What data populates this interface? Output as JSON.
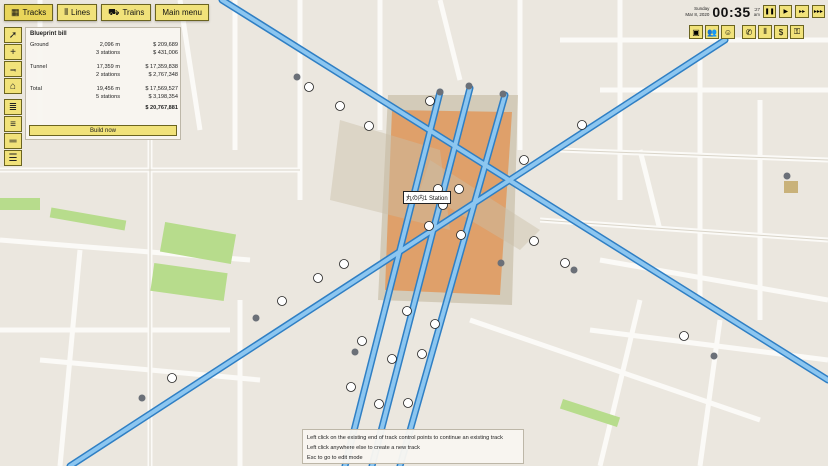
{
  "toolbar": {
    "tracks_label": "Tracks",
    "lines_label": "Lines",
    "trains_label": "Trains",
    "main_menu_label": "Main menu"
  },
  "tools": [
    "select-icon",
    "add-track-icon",
    "elevation-icon",
    "station-icon",
    "track-single-icon",
    "track-double-icon",
    "track-ground-icon",
    "track-tunnel-icon"
  ],
  "blueprint": {
    "title": "Blueprint bill",
    "ground": {
      "label": "Ground",
      "length": "2,096 m",
      "cost": "$ 209,689",
      "stations": "3 stations",
      "stations_cost": "$ 431,006"
    },
    "tunnel": {
      "label": "Tunnel",
      "length": "17,359 m",
      "cost": "$ 17,359,838",
      "stations": "2 stations",
      "stations_cost": "$ 2,767,348"
    },
    "total": {
      "label": "Total",
      "length": "19,456 m",
      "cost": "$ 17,569,527",
      "stations": "5 stations",
      "stations_cost": "$ 3,198,354"
    },
    "grand_total": "$ 20,767,881",
    "build_label": "Build now"
  },
  "clock": {
    "day": "Sunday",
    "date": "Mar 8, 2020",
    "time": "00:35",
    "seconds_top": ":27",
    "seconds_bottom": "am"
  },
  "speed_buttons": [
    "pause-icon",
    "play-icon",
    "fast-forward-icon",
    "fastest-icon"
  ],
  "right_tools": [
    "map-view-icon",
    "people-icon",
    "satisfaction-icon",
    "phone-icon",
    "train-icon",
    "money-icon",
    "lock-icon"
  ],
  "station_label": "丸の内1 Station",
  "hints": [
    "Left click on the existing end of track control points to continue an existing track",
    "Left click anywhere else to create a new track",
    "Esc to go to edit mode"
  ],
  "colors": {
    "accent": "#f1e27a",
    "track": "#6fb1e6",
    "station_zone": "#e0995c",
    "park": "#b7dc8c"
  }
}
